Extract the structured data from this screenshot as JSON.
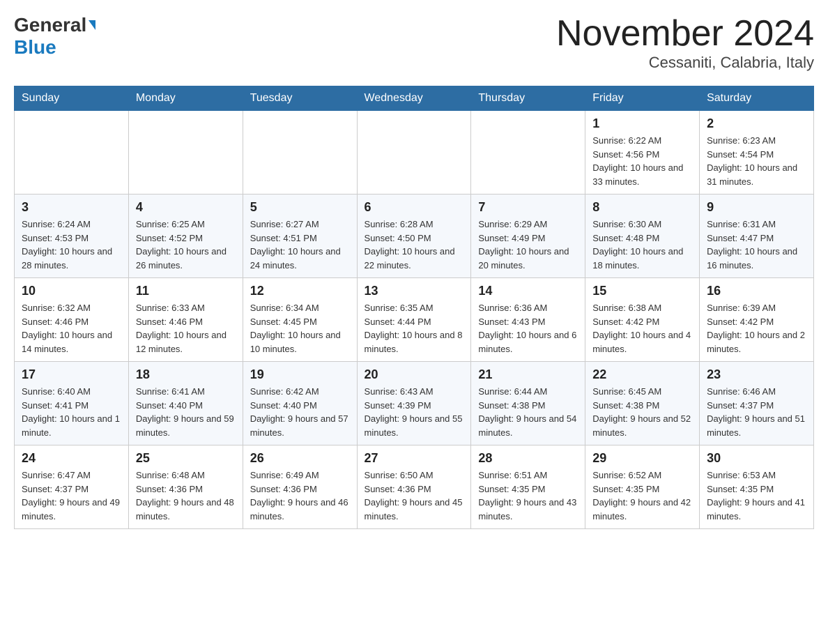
{
  "header": {
    "logo_general": "General",
    "logo_blue": "Blue",
    "month_title": "November 2024",
    "location": "Cessaniti, Calabria, Italy"
  },
  "days_of_week": [
    "Sunday",
    "Monday",
    "Tuesday",
    "Wednesday",
    "Thursday",
    "Friday",
    "Saturday"
  ],
  "weeks": [
    {
      "days": [
        {
          "num": "",
          "info": ""
        },
        {
          "num": "",
          "info": ""
        },
        {
          "num": "",
          "info": ""
        },
        {
          "num": "",
          "info": ""
        },
        {
          "num": "",
          "info": ""
        },
        {
          "num": "1",
          "info": "Sunrise: 6:22 AM\nSunset: 4:56 PM\nDaylight: 10 hours and 33 minutes."
        },
        {
          "num": "2",
          "info": "Sunrise: 6:23 AM\nSunset: 4:54 PM\nDaylight: 10 hours and 31 minutes."
        }
      ]
    },
    {
      "days": [
        {
          "num": "3",
          "info": "Sunrise: 6:24 AM\nSunset: 4:53 PM\nDaylight: 10 hours and 28 minutes."
        },
        {
          "num": "4",
          "info": "Sunrise: 6:25 AM\nSunset: 4:52 PM\nDaylight: 10 hours and 26 minutes."
        },
        {
          "num": "5",
          "info": "Sunrise: 6:27 AM\nSunset: 4:51 PM\nDaylight: 10 hours and 24 minutes."
        },
        {
          "num": "6",
          "info": "Sunrise: 6:28 AM\nSunset: 4:50 PM\nDaylight: 10 hours and 22 minutes."
        },
        {
          "num": "7",
          "info": "Sunrise: 6:29 AM\nSunset: 4:49 PM\nDaylight: 10 hours and 20 minutes."
        },
        {
          "num": "8",
          "info": "Sunrise: 6:30 AM\nSunset: 4:48 PM\nDaylight: 10 hours and 18 minutes."
        },
        {
          "num": "9",
          "info": "Sunrise: 6:31 AM\nSunset: 4:47 PM\nDaylight: 10 hours and 16 minutes."
        }
      ]
    },
    {
      "days": [
        {
          "num": "10",
          "info": "Sunrise: 6:32 AM\nSunset: 4:46 PM\nDaylight: 10 hours and 14 minutes."
        },
        {
          "num": "11",
          "info": "Sunrise: 6:33 AM\nSunset: 4:46 PM\nDaylight: 10 hours and 12 minutes."
        },
        {
          "num": "12",
          "info": "Sunrise: 6:34 AM\nSunset: 4:45 PM\nDaylight: 10 hours and 10 minutes."
        },
        {
          "num": "13",
          "info": "Sunrise: 6:35 AM\nSunset: 4:44 PM\nDaylight: 10 hours and 8 minutes."
        },
        {
          "num": "14",
          "info": "Sunrise: 6:36 AM\nSunset: 4:43 PM\nDaylight: 10 hours and 6 minutes."
        },
        {
          "num": "15",
          "info": "Sunrise: 6:38 AM\nSunset: 4:42 PM\nDaylight: 10 hours and 4 minutes."
        },
        {
          "num": "16",
          "info": "Sunrise: 6:39 AM\nSunset: 4:42 PM\nDaylight: 10 hours and 2 minutes."
        }
      ]
    },
    {
      "days": [
        {
          "num": "17",
          "info": "Sunrise: 6:40 AM\nSunset: 4:41 PM\nDaylight: 10 hours and 1 minute."
        },
        {
          "num": "18",
          "info": "Sunrise: 6:41 AM\nSunset: 4:40 PM\nDaylight: 9 hours and 59 minutes."
        },
        {
          "num": "19",
          "info": "Sunrise: 6:42 AM\nSunset: 4:40 PM\nDaylight: 9 hours and 57 minutes."
        },
        {
          "num": "20",
          "info": "Sunrise: 6:43 AM\nSunset: 4:39 PM\nDaylight: 9 hours and 55 minutes."
        },
        {
          "num": "21",
          "info": "Sunrise: 6:44 AM\nSunset: 4:38 PM\nDaylight: 9 hours and 54 minutes."
        },
        {
          "num": "22",
          "info": "Sunrise: 6:45 AM\nSunset: 4:38 PM\nDaylight: 9 hours and 52 minutes."
        },
        {
          "num": "23",
          "info": "Sunrise: 6:46 AM\nSunset: 4:37 PM\nDaylight: 9 hours and 51 minutes."
        }
      ]
    },
    {
      "days": [
        {
          "num": "24",
          "info": "Sunrise: 6:47 AM\nSunset: 4:37 PM\nDaylight: 9 hours and 49 minutes."
        },
        {
          "num": "25",
          "info": "Sunrise: 6:48 AM\nSunset: 4:36 PM\nDaylight: 9 hours and 48 minutes."
        },
        {
          "num": "26",
          "info": "Sunrise: 6:49 AM\nSunset: 4:36 PM\nDaylight: 9 hours and 46 minutes."
        },
        {
          "num": "27",
          "info": "Sunrise: 6:50 AM\nSunset: 4:36 PM\nDaylight: 9 hours and 45 minutes."
        },
        {
          "num": "28",
          "info": "Sunrise: 6:51 AM\nSunset: 4:35 PM\nDaylight: 9 hours and 43 minutes."
        },
        {
          "num": "29",
          "info": "Sunrise: 6:52 AM\nSunset: 4:35 PM\nDaylight: 9 hours and 42 minutes."
        },
        {
          "num": "30",
          "info": "Sunrise: 6:53 AM\nSunset: 4:35 PM\nDaylight: 9 hours and 41 minutes."
        }
      ]
    }
  ]
}
